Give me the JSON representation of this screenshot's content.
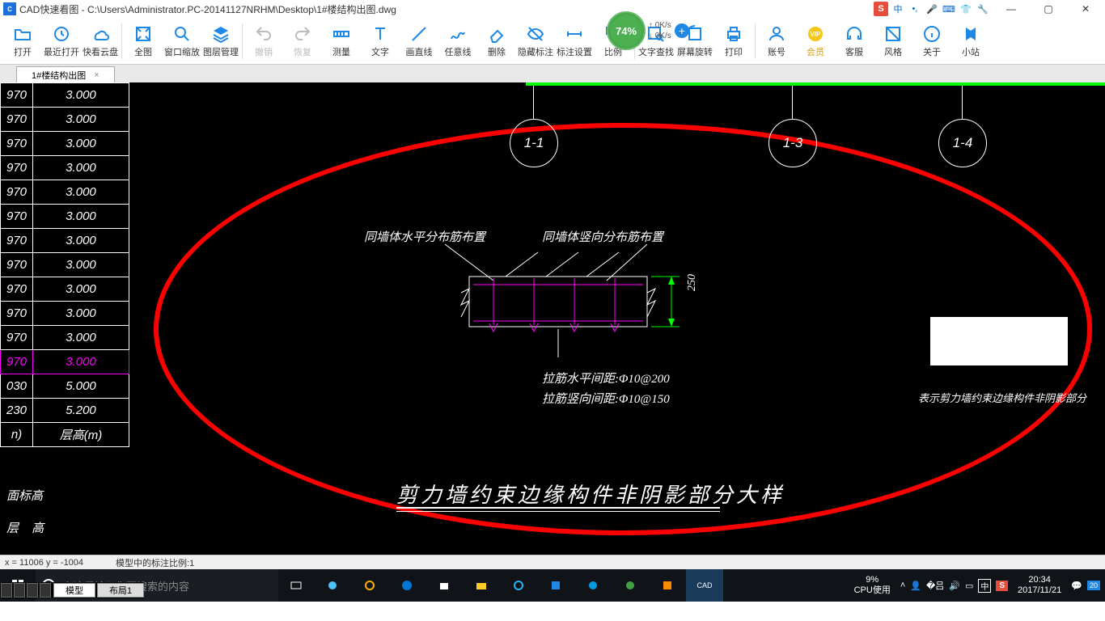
{
  "title": "CAD快速看图 - C:\\Users\\Administrator.PC-20141127NRHM\\Desktop\\1#楼结构出图.dwg",
  "speed": {
    "pct": "74%",
    "up": "0K/s",
    "down": "0K/s"
  },
  "toolbar": [
    {
      "label": "打开",
      "icon": "open"
    },
    {
      "label": "最近打开",
      "icon": "recent"
    },
    {
      "label": "快看云盘",
      "icon": "cloud"
    },
    {
      "sep": true
    },
    {
      "label": "全图",
      "icon": "extent"
    },
    {
      "label": "窗口缩放",
      "icon": "zoomwin"
    },
    {
      "label": "图层管理",
      "icon": "layers"
    },
    {
      "sep": true
    },
    {
      "label": "撤销",
      "icon": "undo",
      "gray": true
    },
    {
      "label": "恢复",
      "icon": "redo",
      "gray": true
    },
    {
      "label": "测量",
      "icon": "measure"
    },
    {
      "label": "文字",
      "icon": "text"
    },
    {
      "label": "画直线",
      "icon": "line"
    },
    {
      "label": "任意线",
      "icon": "poly"
    },
    {
      "label": "删除",
      "icon": "erase"
    },
    {
      "label": "隐藏标注",
      "icon": "hide"
    },
    {
      "label": "标注设置",
      "icon": "dimset"
    },
    {
      "label": "比例",
      "icon": "scale"
    },
    {
      "sep": true
    },
    {
      "label": "文字查找",
      "icon": "find"
    },
    {
      "label": "屏幕旋转",
      "icon": "rotate"
    },
    {
      "label": "打印",
      "icon": "print"
    },
    {
      "sep": true
    },
    {
      "label": "账号",
      "icon": "user"
    },
    {
      "label": "会员",
      "icon": "vip",
      "gold": true
    },
    {
      "label": "客服",
      "icon": "headset"
    },
    {
      "label": "风格",
      "icon": "style"
    },
    {
      "label": "关于",
      "icon": "about"
    },
    {
      "label": "小站",
      "icon": "site"
    }
  ],
  "tab": {
    "name": "1#楼结构出图"
  },
  "tableRows": [
    {
      "a": "970",
      "b": "3.000"
    },
    {
      "a": "970",
      "b": "3.000"
    },
    {
      "a": "970",
      "b": "3.000"
    },
    {
      "a": "970",
      "b": "3.000"
    },
    {
      "a": "970",
      "b": "3.000"
    },
    {
      "a": "970",
      "b": "3.000"
    },
    {
      "a": "970",
      "b": "3.000"
    },
    {
      "a": "970",
      "b": "3.000"
    },
    {
      "a": "970",
      "b": "3.000"
    },
    {
      "a": "970",
      "b": "3.000"
    },
    {
      "a": "970",
      "b": "3.000"
    },
    {
      "a": "970",
      "b": "3.000",
      "mag": true
    },
    {
      "a": "030",
      "b": "5.000"
    },
    {
      "a": "230",
      "b": "5.200"
    },
    {
      "a": "n)",
      "b": "层高(m)"
    }
  ],
  "leftLabels": {
    "l1": "面标高",
    "l2": "层 高"
  },
  "markers": {
    "m1": "1-1",
    "m2": "1-3",
    "m3": "1-4"
  },
  "detail": {
    "topLeft": "同墙体水平分布筋布置",
    "topRight": "同墙体竖向分布筋布置",
    "dim": "250",
    "note1": "拉筋水平间距:Φ10@200",
    "note2": "拉筋竖向间距:Φ10@150",
    "title": "剪力墙约束边缘构件非阴影部分大样",
    "legend": "表示剪力墙约束边缘构件非阴影部分"
  },
  "modelTabs": {
    "t1": "模型",
    "t2": "布局1"
  },
  "status": {
    "coord": "x = 11006  y = -1004",
    "scale": "模型中的标注比例:1"
  },
  "taskbar": {
    "search": "在这里输入你要搜索的内容",
    "cpu_pct": "9%",
    "cpu_lbl": "CPU使用",
    "time": "20:34",
    "date": "2017/11/21",
    "ime": "中",
    "ime_s": "S",
    "badge": "20"
  },
  "ime_top": {
    "s": "S",
    "zhong": "中"
  }
}
